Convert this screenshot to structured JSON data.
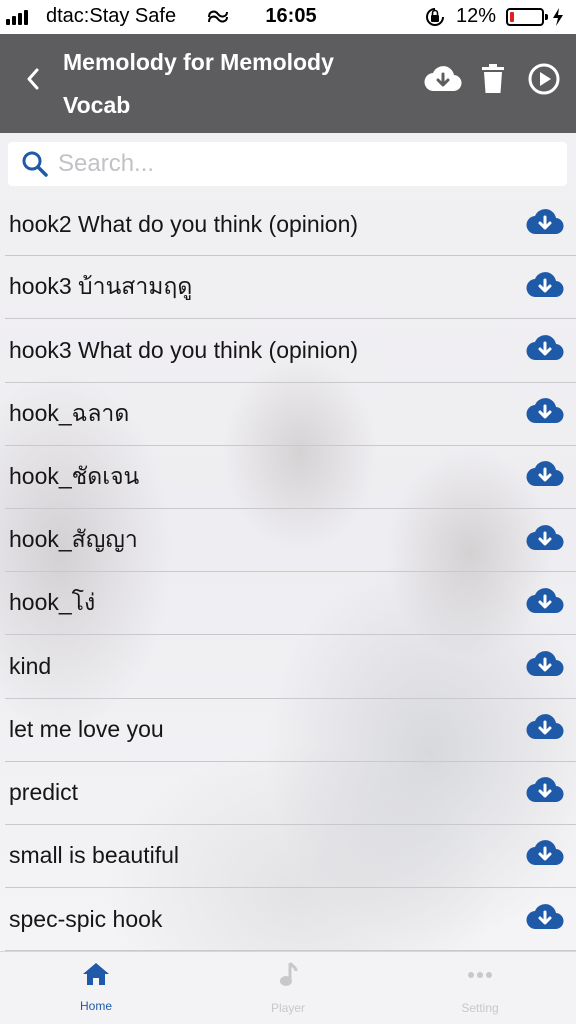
{
  "status_bar": {
    "carrier": "dtac:Stay Safe",
    "time": "16:05",
    "battery_percent": "12%",
    "battery_level": 0.12
  },
  "header": {
    "title": "Memolody for Memolody Vocab",
    "back_icon": "chevron-left-icon",
    "actions": [
      "cloud-download-icon",
      "trash-icon",
      "play-circle-icon"
    ]
  },
  "search": {
    "placeholder": "Search...",
    "value": ""
  },
  "items": [
    {
      "label": "hook2 What do you think (opinion)"
    },
    {
      "label": "hook3 บ้านสามฤดู"
    },
    {
      "label": "hook3 What do you think (opinion)"
    },
    {
      "label": "hook_ฉลาด"
    },
    {
      "label": "hook_ชัดเจน"
    },
    {
      "label": "hook_สัญญา"
    },
    {
      "label": "hook_โง่"
    },
    {
      "label": "kind"
    },
    {
      "label": "let me love you"
    },
    {
      "label": "predict"
    },
    {
      "label": "small is beautiful"
    },
    {
      "label": "spec-spic hook"
    }
  ],
  "tabs": [
    {
      "label": "Home",
      "icon": "home-icon",
      "active": true
    },
    {
      "label": "Player",
      "icon": "music-note-icon",
      "active": false
    },
    {
      "label": "Setting",
      "icon": "more-dots-icon",
      "active": false
    }
  ],
  "colors": {
    "header_bg": "#5d5d5f",
    "accent": "#1e5aa8",
    "battery_low": "#e02020"
  }
}
